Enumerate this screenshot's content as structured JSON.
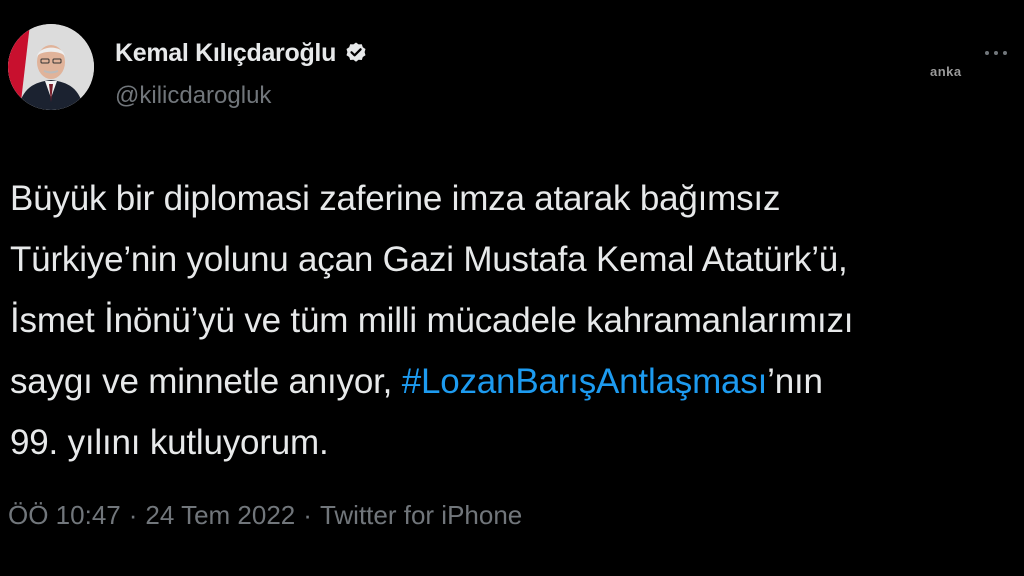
{
  "author": {
    "display_name": "Kemal Kılıçdaroğlu",
    "handle": "@kilicdarogluk",
    "verified_icon": "verified-badge-icon"
  },
  "watermark": "anka",
  "tweet": {
    "line1": "Büyük bir diplomasi zaferine imza atarak bağımsız",
    "line2": "Türkiye’nin yolunu açan Gazi Mustafa Kemal Atatürk’ü,",
    "line3": "İsmet İnönü’yü ve tüm milli mücadele kahramanlarımızı",
    "line4_before": "saygı ve minnetle anıyor, ",
    "hashtag": "#LozanBarışAntlaşması",
    "line4_after": "’nın",
    "line5": "99. yılını kutluyorum."
  },
  "meta": {
    "time": "ÖÖ 10:47",
    "separator": "·",
    "date": "24 Tem 2022",
    "source": "Twitter for iPhone"
  },
  "colors": {
    "background": "#000000",
    "text": "#e7e9ea",
    "secondary": "#71767b",
    "link": "#1d9bf0"
  }
}
